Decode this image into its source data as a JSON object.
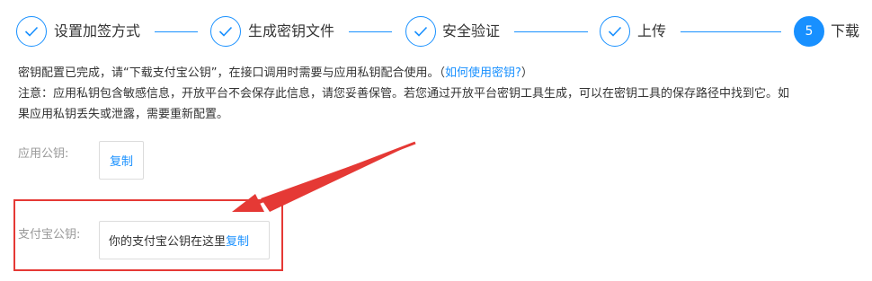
{
  "steps": [
    {
      "label": "设置加签方式",
      "state": "done",
      "icon": "check-icon"
    },
    {
      "label": "生成密钥文件",
      "state": "done",
      "icon": "check-icon"
    },
    {
      "label": "安全验证",
      "state": "done",
      "icon": "check-icon"
    },
    {
      "label": "上传",
      "state": "done",
      "icon": "check-icon"
    },
    {
      "label": "下载",
      "state": "active",
      "number": "5"
    }
  ],
  "notice": {
    "line1_text": "密钥配置已完成，请“下载支付宝公钥”，在接口调用时需要与应用私钥配合使用。（",
    "line1_link": "如何使用密钥?",
    "line1_end": "）",
    "line2": "注意：应用私钥包含敏感信息，开放平台不会保存此信息，请您妥善保管。若您通过开放平台密钥工具生成，可以在密钥工具的保存路径中找到它。如",
    "line3": "果应用私钥丢失或泄露，需要重新配置。"
  },
  "app_public_key": {
    "label": "应用公钥:",
    "copy_label": "复制"
  },
  "alipay_public_key": {
    "label": "支付宝公钥:",
    "value": "你的支付宝公钥在这里",
    "copy_label": "复制"
  },
  "colors": {
    "accent": "#1890ff",
    "annotation": "#e53935"
  }
}
